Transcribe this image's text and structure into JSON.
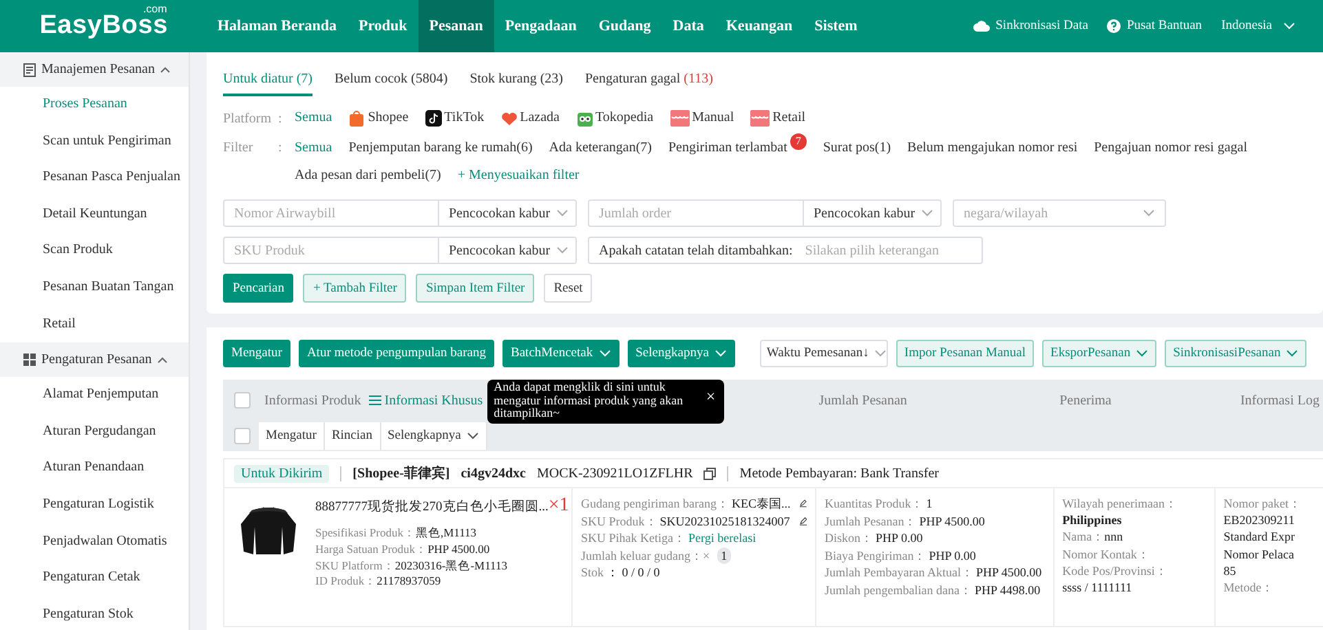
{
  "nav": {
    "logo": "EasyBoss",
    "logo_sup": ".com",
    "items": [
      {
        "label": "Halaman Beranda",
        "selected": false
      },
      {
        "label": "Produk",
        "selected": false
      },
      {
        "label": "Pesanan",
        "selected": true
      },
      {
        "label": "Pengadaan",
        "selected": false
      },
      {
        "label": "Gudang",
        "selected": false
      },
      {
        "label": "Data",
        "selected": false
      },
      {
        "label": "Keuangan",
        "selected": false
      },
      {
        "label": "Sistem",
        "selected": false
      }
    ],
    "sync": "Sinkronisasi Data",
    "help": "Pusat Bantuan",
    "language": "Indonesia"
  },
  "sidebar": [
    {
      "title": "Manajemen Pesanan",
      "kind": "doc",
      "expanded": true,
      "items": [
        {
          "label": "Proses Pesanan",
          "selected": true
        },
        {
          "label": "Scan untuk Pengiriman",
          "selected": false
        },
        {
          "label": "Pesanan Pasca Penjualan",
          "selected": false
        },
        {
          "label": "Detail Keuntungan",
          "selected": false
        },
        {
          "label": "Scan Produk",
          "selected": false
        },
        {
          "label": "Pesanan Buatan Tangan",
          "selected": false
        },
        {
          "label": "Retail",
          "selected": false
        }
      ]
    },
    {
      "title": "Pengaturan Pesanan",
      "kind": "grid",
      "expanded": true,
      "items": [
        {
          "label": "Alamat Penjemputan",
          "selected": false
        },
        {
          "label": "Aturan Pergudangan",
          "selected": false
        },
        {
          "label": "Aturan Penandaan",
          "selected": false
        },
        {
          "label": "Pengaturan Logistik",
          "selected": false
        },
        {
          "label": "Penjadwalan Otomatis",
          "selected": false
        },
        {
          "label": "Pengaturan Cetak",
          "selected": false
        },
        {
          "label": "Pengaturan Stok",
          "selected": false
        }
      ]
    }
  ],
  "status_tabs": [
    {
      "label": "Untuk diatur",
      "count": "(7)",
      "selected": true,
      "alert": false
    },
    {
      "label": "Belum cocok",
      "count": "(5804)",
      "selected": false,
      "alert": false
    },
    {
      "label": "Stok kurang",
      "count": "(23)",
      "selected": false,
      "alert": false
    },
    {
      "label": "Pengaturan gagal",
      "count": "(113)",
      "selected": false,
      "alert": true
    }
  ],
  "platform": {
    "label": "Platform",
    "colon": ":",
    "options": [
      {
        "label": "Semua",
        "kind": "all",
        "selected": true
      },
      {
        "label": "Shopee",
        "kind": "shopee",
        "selected": false
      },
      {
        "label": "TikTok",
        "kind": "tiktok",
        "selected": false
      },
      {
        "label": "Lazada",
        "kind": "lazada",
        "selected": false
      },
      {
        "label": "Tokopedia",
        "kind": "tokopedia",
        "selected": false
      },
      {
        "label": "Manual",
        "kind": "manual",
        "selected": false
      },
      {
        "label": "Retail",
        "kind": "manual",
        "selected": false
      }
    ]
  },
  "filter": {
    "label": "Filter",
    "colon": ":",
    "options": [
      {
        "label": "Semua",
        "selected": true
      },
      {
        "label": "Penjemputan barang ke rumah(6)",
        "selected": false
      },
      {
        "label": "Ada keterangan(7)",
        "selected": false
      },
      {
        "label": "Pengiriman terlambat",
        "badge": "7",
        "selected": false
      },
      {
        "label": "Surat pos(1)",
        "selected": false
      },
      {
        "label": "Belum mengajukan nomor resi",
        "selected": false
      },
      {
        "label": "Pengajuan nomor resi gagal",
        "selected": false
      },
      {
        "label": "Ada pesan dari pembeli(7)",
        "selected": false
      }
    ],
    "customize": "+ Menyesuaikan filter"
  },
  "search_rows": [
    [
      {
        "kind": "input",
        "placeholder": "Nomor Airwaybill"
      },
      {
        "kind": "select",
        "value": "Pencocokan kabur"
      },
      {
        "kind": "input",
        "placeholder": "Jumlah order"
      },
      {
        "kind": "select",
        "value": "Pencocokan kabur"
      },
      {
        "kind": "select_empty",
        "placeholder": "negara/wilayah"
      }
    ],
    [
      {
        "kind": "input",
        "placeholder": "SKU Produk"
      },
      {
        "kind": "select",
        "value": "Pencocokan kabur"
      },
      {
        "kind": "note",
        "label": "Apakah catatan telah ditambahkan:",
        "placeholder": "Silakan pilih keterangan"
      }
    ]
  ],
  "search_buttons": [
    {
      "label": "Pencarian",
      "kind": "primary"
    },
    {
      "label": "+ Tambah Filter",
      "kind": "light"
    },
    {
      "label": "Simpan Item Filter",
      "kind": "light"
    },
    {
      "label": "Reset",
      "kind": "plain"
    }
  ],
  "toolbar_left": [
    {
      "label": "Mengatur",
      "dropdown": false
    },
    {
      "label": "Atur metode pengumpulan barang",
      "dropdown": false
    },
    {
      "label": "BatchMencetak",
      "dropdown": true
    },
    {
      "label": "Selengkapnya",
      "dropdown": true
    }
  ],
  "sort": "Waktu Pemesanan↓",
  "toolbar_right": [
    {
      "label": "Impor Pesanan Manual",
      "dropdown": false
    },
    {
      "label": "EksporPesanan",
      "dropdown": true
    },
    {
      "label": "SinkronisasiPesanan",
      "dropdown": true
    }
  ],
  "table": {
    "select_all_checked": false,
    "product_heading": "Informasi Produk",
    "custom_link": "Informasi Khusus",
    "columns": [
      "Jumlah Pesanan",
      "Penerima",
      "Informasi Log"
    ],
    "tooltip": "Anda dapat mengklik di sini untuk mengatur informasi produk yang akan ditampilkan~",
    "tooltip_close": "×",
    "bulk_checked": false,
    "bulk_actions": [
      {
        "label": "Mengatur",
        "dropdown": false
      },
      {
        "label": "Rincian",
        "dropdown": false
      },
      {
        "label": "Selengkapnya",
        "dropdown": true
      }
    ]
  },
  "order": {
    "status": "Untuk Dikirim",
    "shop": "[Shopee-菲律宾]",
    "buyer": "ci4gv24dxc",
    "order_no": "MOCK-230921LO1ZFLHR",
    "payment": "Metode Pembayaran: Bank Transfer",
    "product": {
      "title": "88877777现货批发270克白色小毛圈圆...",
      "qty": "×1",
      "lines": [
        {
          "label": "Spesifikasi Produk：",
          "value": "黑色,M1113"
        },
        {
          "label": "Harga Satuan Produk：",
          "value": "PHP 4500.00"
        },
        {
          "label": "SKU Platform：",
          "value": "20230316-黑色-M1113"
        },
        {
          "label": "ID Produk：",
          "value": "21178937059"
        }
      ]
    },
    "warehouse": [
      {
        "label": "Gudang pengiriman barang：",
        "value": "KEC泰国...",
        "kind": "edit"
      },
      {
        "label": "SKU Produk：",
        "value": "SKU20231025181324007",
        "kind": "edit"
      },
      {
        "label": "SKU Pihak Ketiga：",
        "value": "Pergi berelasi",
        "kind": "link"
      },
      {
        "label": "Jumlah keluar gudang：×",
        "value": "1",
        "kind": "pill"
      },
      {
        "label": "Stok",
        "value": "：  0 / 0 / 0",
        "kind": "plain"
      }
    ],
    "amounts": [
      {
        "label": "Kuantitas Produk：",
        "value": "1"
      },
      {
        "label": "Jumlah Pesanan：",
        "value": "PHP 4500.00"
      },
      {
        "label": "Diskon：",
        "value": "PHP 0.00"
      },
      {
        "label": "Biaya Pengiriman：",
        "value": "PHP 0.00"
      },
      {
        "label": "Jumlah Pembayaran Aktual：",
        "value": "PHP 4500.00"
      },
      {
        "label": "Jumlah pengembalian dana：",
        "value": "PHP 4498.00"
      }
    ],
    "recipient": [
      {
        "label": "Wilayah penerimaan：",
        "value": "Philippines"
      },
      {
        "label": "Nama：",
        "value": "nnn"
      },
      {
        "label": "Nomor Kontak："
      },
      {
        "label": "Kode Pos/Provinsi：",
        "value": "ssss / 1111111"
      }
    ],
    "logistics": [
      "Nomor paket：",
      "EB202309211",
      "Standard Expr",
      "Nomor Pelaca",
      "85",
      "Metode："
    ]
  }
}
